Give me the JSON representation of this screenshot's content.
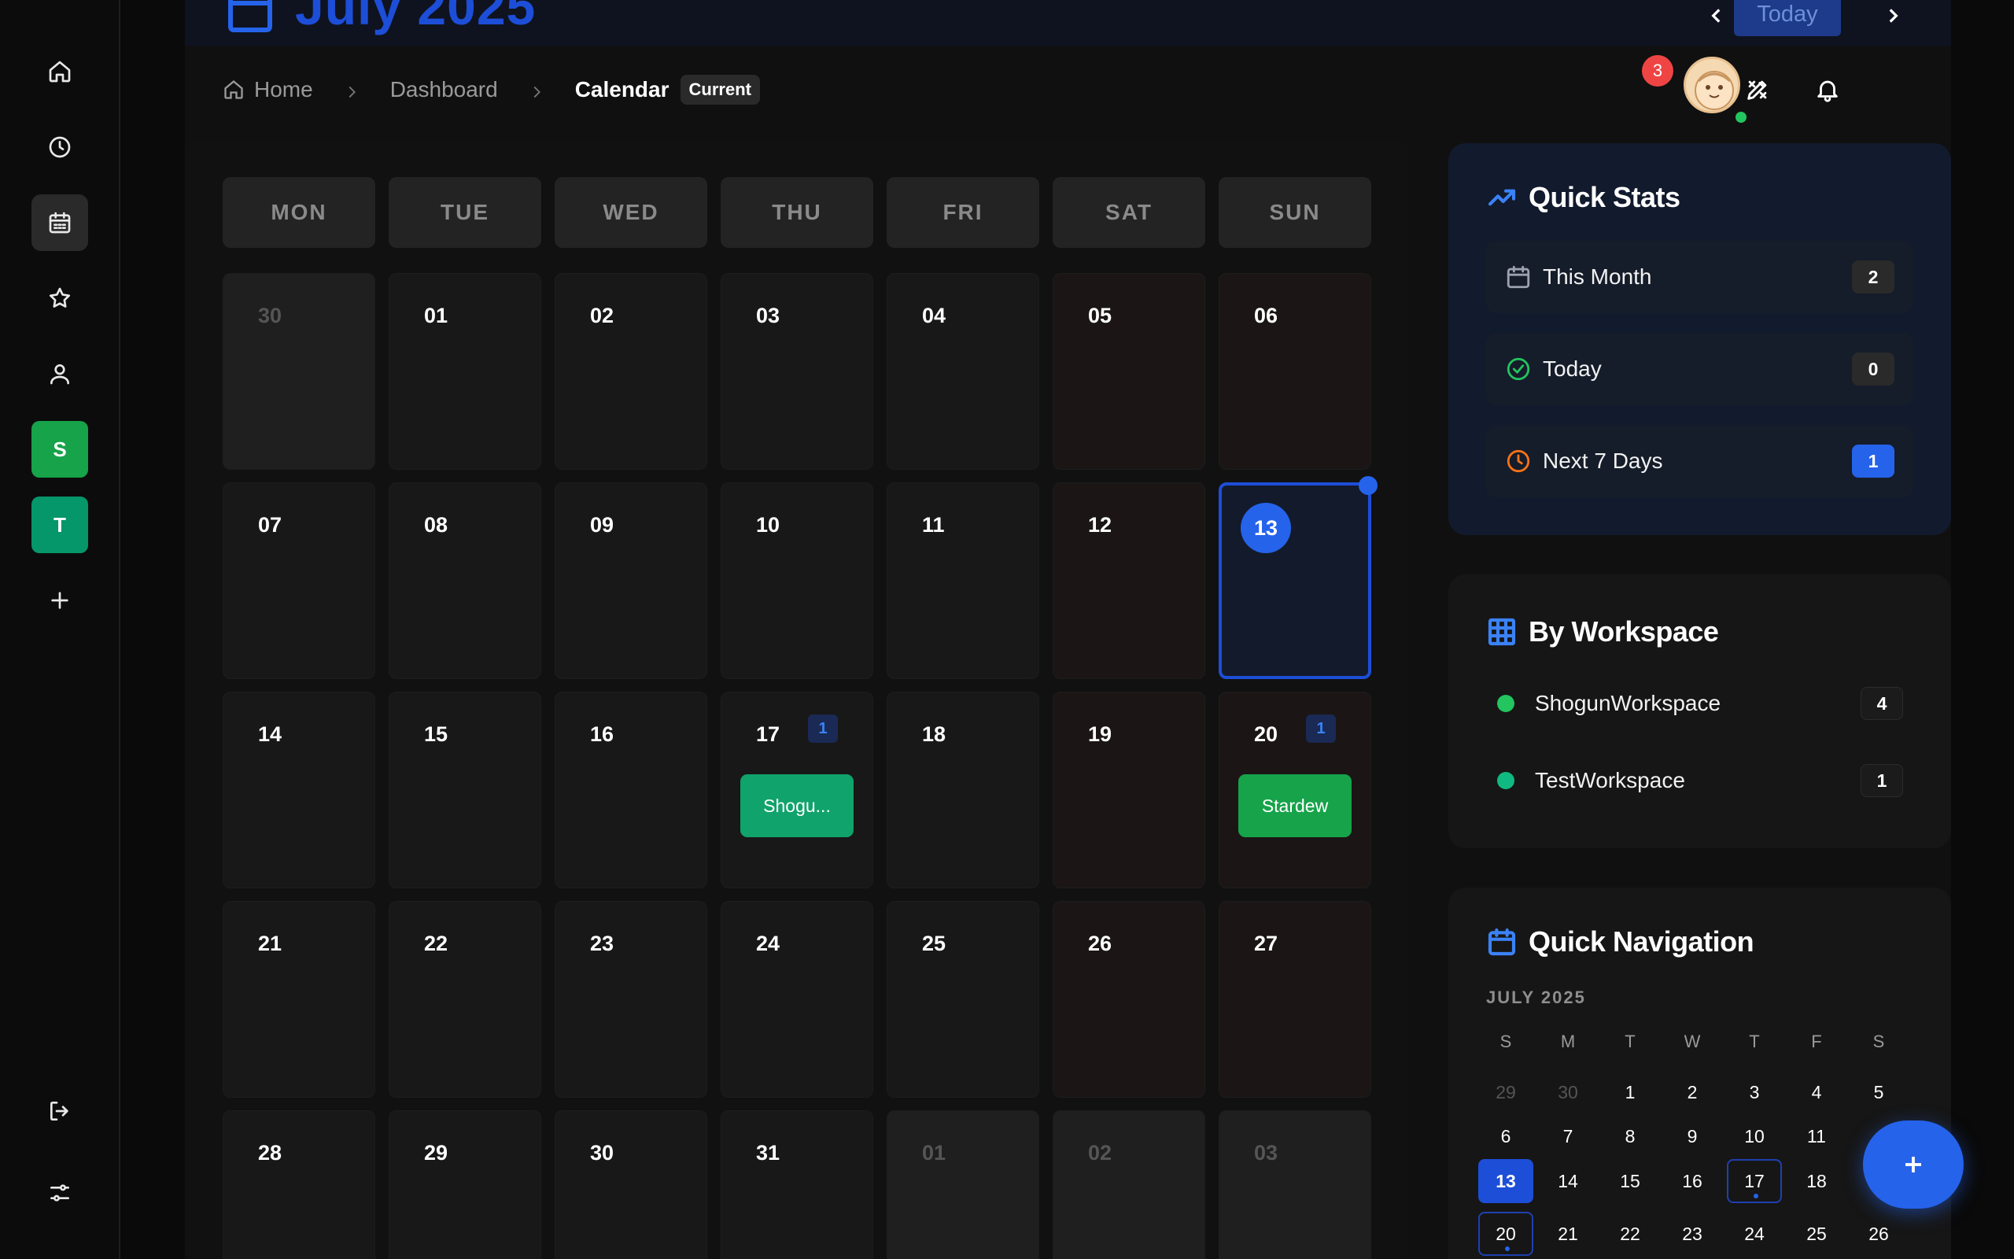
{
  "header": {
    "title": "July 2025",
    "today_label": "Today",
    "notifications": "3"
  },
  "breadcrumb": {
    "home": "Home",
    "dashboard": "Dashboard",
    "current": "Calendar",
    "badge": "Current"
  },
  "sidebar": {
    "workspaces": [
      {
        "letter": "S",
        "color": "#16a34a"
      },
      {
        "letter": "T",
        "color": "#059669"
      }
    ]
  },
  "calendar": {
    "weekdays": [
      "MON",
      "TUE",
      "WED",
      "THU",
      "FRI",
      "SAT",
      "SUN"
    ],
    "weeks": [
      [
        {
          "d": "30",
          "other": true
        },
        {
          "d": "01"
        },
        {
          "d": "02"
        },
        {
          "d": "03"
        },
        {
          "d": "04"
        },
        {
          "d": "05"
        },
        {
          "d": "06"
        }
      ],
      [
        {
          "d": "07"
        },
        {
          "d": "08"
        },
        {
          "d": "09"
        },
        {
          "d": "10"
        },
        {
          "d": "11"
        },
        {
          "d": "12"
        },
        {
          "d": "13",
          "today": true
        }
      ],
      [
        {
          "d": "14"
        },
        {
          "d": "15"
        },
        {
          "d": "16"
        },
        {
          "d": "17",
          "count": "1",
          "event": "Shogu...",
          "color": "#10a36b"
        },
        {
          "d": "18"
        },
        {
          "d": "19"
        },
        {
          "d": "20",
          "count": "1",
          "event": "Stardew",
          "color": "#16a34a"
        }
      ],
      [
        {
          "d": "21"
        },
        {
          "d": "22"
        },
        {
          "d": "23"
        },
        {
          "d": "24"
        },
        {
          "d": "25"
        },
        {
          "d": "26"
        },
        {
          "d": "27"
        }
      ],
      [
        {
          "d": "28"
        },
        {
          "d": "29"
        },
        {
          "d": "30"
        },
        {
          "d": "31"
        },
        {
          "d": "01",
          "other": true
        },
        {
          "d": "02",
          "other": true
        },
        {
          "d": "03",
          "other": true
        }
      ]
    ]
  },
  "quick_stats": {
    "title": "Quick Stats",
    "rows": [
      {
        "label": "This Month",
        "value": "2",
        "icon": "calendar-icon",
        "color": "#9ca3af"
      },
      {
        "label": "Today",
        "value": "0",
        "icon": "check-circle-icon",
        "color": "#22c55e"
      },
      {
        "label": "Next 7 Days",
        "value": "1",
        "icon": "clock-icon",
        "color": "#f97316"
      }
    ]
  },
  "by_workspace": {
    "title": "By Workspace",
    "rows": [
      {
        "name": "ShogunWorkspace",
        "count": "4",
        "color": "#22c55e"
      },
      {
        "name": "TestWorkspace",
        "count": "1",
        "color": "#10b981"
      }
    ]
  },
  "quick_nav": {
    "title": "Quick Navigation",
    "month": "JULY 2025",
    "weekdays": [
      "S",
      "M",
      "T",
      "W",
      "T",
      "F",
      "S"
    ],
    "rows": [
      [
        "29",
        "30",
        "1",
        "2",
        "3",
        "4",
        "5"
      ],
      [
        "6",
        "7",
        "8",
        "9",
        "10",
        "11",
        ""
      ],
      [
        "13",
        "14",
        "15",
        "16",
        "17",
        "18",
        ""
      ],
      [
        "20",
        "21",
        "22",
        "23",
        "24",
        "25",
        "26"
      ]
    ]
  },
  "colors": {
    "accent": "#2563eb"
  }
}
